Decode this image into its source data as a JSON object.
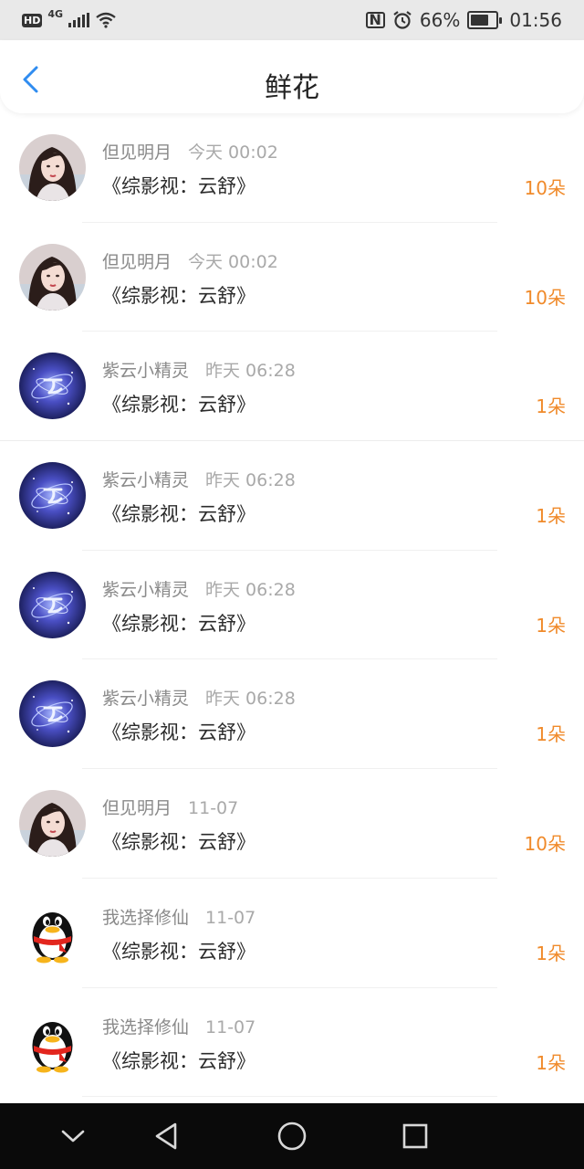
{
  "status_bar": {
    "network_type": "4G",
    "battery_percent": "66%",
    "time": "01:56",
    "icons": [
      "hd-icon",
      "signal-icon",
      "wifi-icon",
      "nfc-icon",
      "alarm-icon",
      "battery-icon"
    ]
  },
  "header": {
    "back_icon": "chevron-left-icon",
    "title": "鲜花"
  },
  "colors": {
    "accent": "#2f8cf0",
    "count": "#f08a2a",
    "name": "#8a8a8a",
    "time": "#a9a9a9"
  },
  "items": [
    {
      "user": "但见明月",
      "time": "今天 00:02",
      "book": "《综影视：云舒》",
      "count": "10朵",
      "avatar": "girl-avatar"
    },
    {
      "user": "但见明月",
      "time": "今天 00:02",
      "book": "《综影视：云舒》",
      "count": "10朵",
      "avatar": "girl-avatar"
    },
    {
      "user": "紫云小精灵",
      "time": "昨天 06:28",
      "book": "《综影视：云舒》",
      "count": "1朵",
      "avatar": "galaxy-avatar"
    },
    {
      "user": "紫云小精灵",
      "time": "昨天 06:28",
      "book": "《综影视：云舒》",
      "count": "1朵",
      "avatar": "galaxy-avatar"
    },
    {
      "user": "紫云小精灵",
      "time": "昨天 06:28",
      "book": "《综影视：云舒》",
      "count": "1朵",
      "avatar": "galaxy-avatar"
    },
    {
      "user": "紫云小精灵",
      "time": "昨天 06:28",
      "book": "《综影视：云舒》",
      "count": "1朵",
      "avatar": "galaxy-avatar"
    },
    {
      "user": "但见明月",
      "time": "11-07",
      "book": "《综影视：云舒》",
      "count": "10朵",
      "avatar": "girl-avatar"
    },
    {
      "user": "我选择修仙",
      "time": "11-07",
      "book": "《综影视：云舒》",
      "count": "1朵",
      "avatar": "penguin-avatar"
    },
    {
      "user": "我选择修仙",
      "time": "11-07",
      "book": "《综影视：云舒》",
      "count": "1朵",
      "avatar": "penguin-avatar"
    }
  ],
  "nav_bar": {
    "icons": [
      "collapse-icon",
      "back-triangle-icon",
      "home-circle-icon",
      "recents-square-icon"
    ]
  }
}
